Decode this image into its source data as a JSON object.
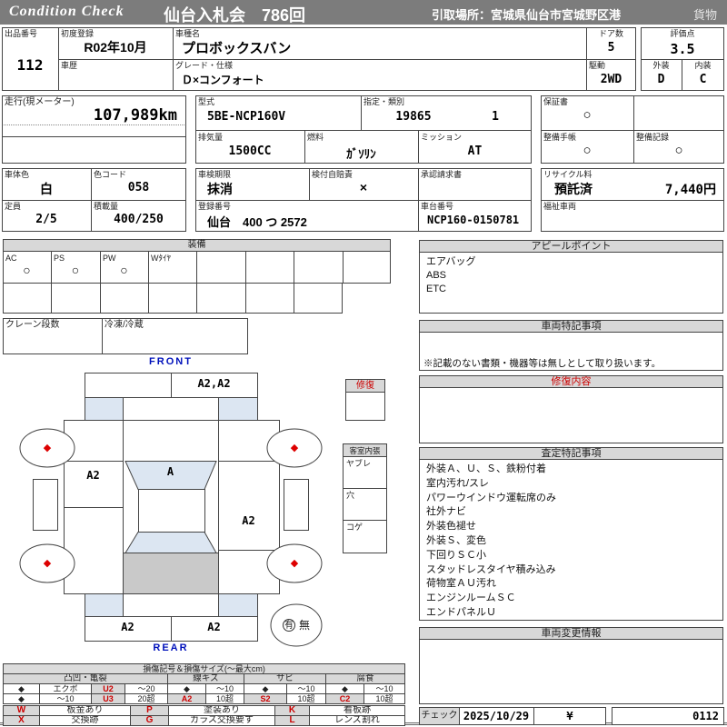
{
  "header": {
    "brand": "Condition  Check",
    "title": "仙台入札会　786回",
    "pickup": "引取場所：宮城県仙台市宮城野区港",
    "category": "貨物"
  },
  "top": {
    "lot_label": "出品番号",
    "lot_no": "112",
    "first_reg_label": "初度登録",
    "first_reg": "R02年10月",
    "history_label": "車歴",
    "model_label": "車種名",
    "model": "プロボックスバン",
    "grade_label": "グレード・仕様",
    "grade": "Ｄ×コンフォート",
    "doors_label": "ドア数",
    "doors": "5",
    "drive_label": "駆動",
    "drive": "2WD",
    "score_label": "評価点",
    "score": "3.5",
    "ext_label": "外装",
    "ext": "D",
    "int_label": "内装",
    "int": "C"
  },
  "specs": {
    "odo_label": "走行(現メーター)",
    "odo": "107,989km",
    "model_code_label": "型式",
    "model_code": "5BE-NCP160V",
    "class_label": "指定・類別",
    "class1": "19865",
    "class2": "1",
    "warranty_label": "保証書",
    "warranty": "○",
    "disp_label": "排気量",
    "disp": "1500CC",
    "fuel_label": "燃料",
    "fuel": "ｶﾞｿﾘﾝ",
    "mission_label": "ミッション",
    "mission": "AT",
    "book_label": "整備手帳",
    "book": "○",
    "record_label": "整備記録",
    "record": "○",
    "color_label": "車体色",
    "color": "白",
    "color_code_label": "色コード",
    "color_code": "058",
    "inspection_label": "車検期限",
    "inspection": "抹消",
    "insurance_label": "検付自賠責",
    "insurance": "×",
    "approval_label": "承認請求書",
    "recycle_label": "リサイクル料",
    "recycle_status": "預託済",
    "recycle_fee": "7,440円",
    "capacity_label": "定員",
    "capacity": "2/5",
    "load_label": "積載量",
    "load": "400/250",
    "regno_label": "登録番号",
    "regno": "仙台　400 つ 2572",
    "chassis_label": "車台番号",
    "chassis": "NCP160-0150781",
    "welfare_label": "福祉車両"
  },
  "equipment": {
    "title": "装備",
    "cells": [
      {
        "label": "AC",
        "value": "○"
      },
      {
        "label": "PS",
        "value": "○"
      },
      {
        "label": "PW",
        "value": "○"
      },
      {
        "label": "Wﾀｲﾔ",
        "value": ""
      },
      {
        "label": "",
        "value": ""
      },
      {
        "label": "",
        "value": ""
      },
      {
        "label": "",
        "value": ""
      },
      {
        "label": "",
        "value": ""
      }
    ],
    "crane_label": "クレーン段数",
    "fridge_label": "冷凍/冷蔵"
  },
  "diagram": {
    "front": "FRONT",
    "rear": "REAR",
    "front_bumper_mark": "A2,A2",
    "left_door_mark": "A2",
    "windshield_mark": "A",
    "right_door_mark": "A2",
    "rear_bumper_left_mark": "A2",
    "rear_bumper_right_mark": "A2",
    "spare_yes": "有",
    "spare_no": "無",
    "repair_box_label": "修復",
    "cabin_box_label": "客室内張",
    "cabin_rows": [
      "ヤブレ",
      "穴",
      "コゲ"
    ]
  },
  "appeal": {
    "title": "アピールポイント",
    "items": [
      "エアバッグ",
      "ABS",
      "ETC"
    ]
  },
  "vehicle_notes": {
    "title": "車両特記事項",
    "note": "※記載のない書類・機器等は無しとして取り扱います。"
  },
  "repair_details": {
    "title": "修復内容"
  },
  "assessment": {
    "title": "査定特記事項",
    "items": [
      "外装Ａ、Ｕ、Ｓ、鉄粉付着",
      "室内汚れ/スレ",
      "パワーウインドウ運転席のみ",
      "社外ナビ",
      "外装色褪せ",
      "外装Ｓ、変色",
      "下回りＳＣ小",
      "スタッドレスタイヤ積み込み",
      "荷物室ＡＵ汚れ",
      "エンジンルームＳＣ",
      "エンドパネルＵ"
    ]
  },
  "change_info": {
    "title": "車両変更情報"
  },
  "check": {
    "label": "チェック",
    "date": "2025/10/29",
    "mark": "¥",
    "code": "0112"
  },
  "legend": {
    "title": "損傷記号＆損傷サイズ(〜最大cm)",
    "g1": {
      "name": "凸凹・亀裂",
      "r1": [
        "◆",
        "エクボ",
        "U2",
        "〜20"
      ],
      "r2": [
        "◆",
        "〜10",
        "U3",
        "20超"
      ]
    },
    "g2": {
      "name": "線キズ",
      "r1": [
        "◆",
        "〜10"
      ],
      "r2": [
        "A2",
        "10超"
      ]
    },
    "g3": {
      "name": "サビ",
      "r1": [
        "◆",
        "〜10"
      ],
      "r2": [
        "S2",
        "10超"
      ]
    },
    "g4": {
      "name": "腐食",
      "r1": [
        "◆",
        "〜10"
      ],
      "r2": [
        "C2",
        "10超"
      ]
    },
    "codes": {
      "w": "W",
      "w_desc": "板金あり",
      "p": "P",
      "p_desc": "塗装あり",
      "k": "K",
      "k_desc": "看板跡",
      "x": "X",
      "x_desc": "交換跡",
      "g": "G",
      "g_desc": "ガラス交換要す",
      "l": "L",
      "l_desc": "レンズ割れ"
    }
  },
  "icons": {
    "diamond": "◆"
  }
}
